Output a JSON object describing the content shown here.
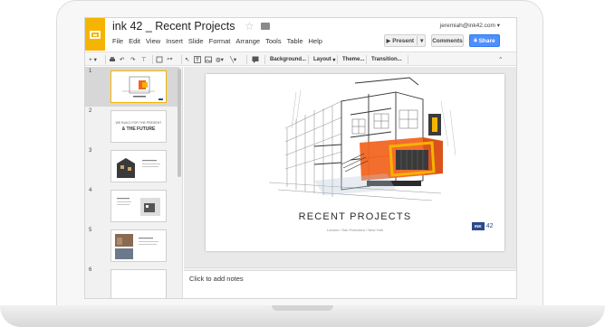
{
  "app": {
    "doc_title": "ink 42 _ Recent Projects",
    "user_email": "jeremiah@ink42.com",
    "menu": [
      "File",
      "Edit",
      "View",
      "Insert",
      "Slide",
      "Format",
      "Arrange",
      "Tools",
      "Table",
      "Help"
    ],
    "buttons": {
      "present": "Present",
      "comments": "Comments",
      "share": "Share"
    }
  },
  "toolbar": {
    "background": "Background...",
    "layout": "Layout",
    "theme": "Theme...",
    "transition": "Transition..."
  },
  "filmstrip": {
    "slides": [
      {
        "num": "1",
        "active": true
      },
      {
        "num": "2",
        "line1": "WE BUILD FOR THE PRESENT",
        "line2": "& THE FUTURE"
      },
      {
        "num": "3"
      },
      {
        "num": "4"
      },
      {
        "num": "5"
      },
      {
        "num": "6"
      }
    ]
  },
  "slide": {
    "title": "RECENT PROJECTS",
    "subtitle": "London / San Francisco / New York",
    "logo_text": "INK",
    "logo_num": "42"
  },
  "notes": {
    "placeholder": "Click to add notes"
  },
  "colors": {
    "accent": "#f4b400",
    "share": "#4d90fe",
    "brand": "#2b4a8a",
    "orange": "#f26522"
  }
}
